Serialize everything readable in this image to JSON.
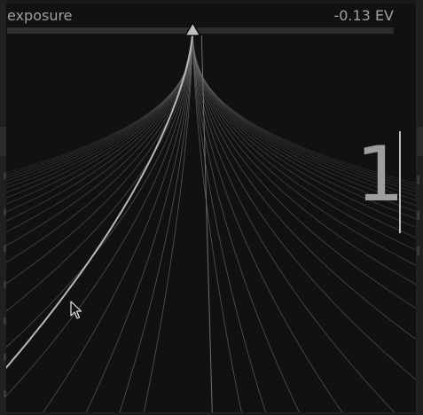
{
  "slider": {
    "label": "exposure",
    "value_text": "-0.13 EV",
    "position_fraction": 0.48
  },
  "fine_tune": {
    "scale_digit": "1"
  },
  "colors": {
    "background": "#111111",
    "text": "#a0a0a0",
    "main_curve": "#b8b8b8",
    "guide_curve": "#6f6f6f",
    "marker": "#c0c0c0"
  },
  "icons": {
    "marker": "triangle-up-icon",
    "pointer": "mouse-pointer-icon"
  }
}
